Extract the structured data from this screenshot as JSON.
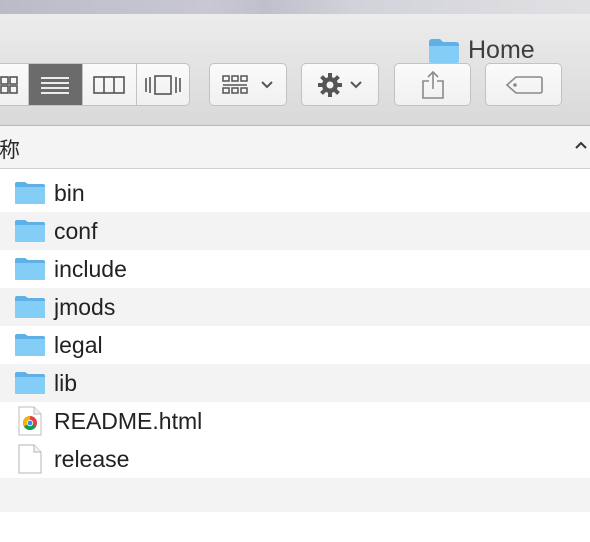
{
  "window": {
    "title": "Home",
    "title_icon": "folder-icon"
  },
  "toolbar": {
    "view_buttons": [
      {
        "name": "icon-view",
        "icon": "grid-icon"
      },
      {
        "name": "list-view",
        "icon": "list-icon",
        "selected": true
      },
      {
        "name": "column-view",
        "icon": "columns-icon"
      },
      {
        "name": "gallery-view",
        "icon": "coverflow-icon"
      }
    ],
    "arrange": {
      "icon": "arrange-icon"
    },
    "action": {
      "icon": "gear-icon"
    },
    "share": {
      "icon": "share-icon"
    },
    "tags": {
      "icon": "tag-icon"
    }
  },
  "header": {
    "name_column": "称",
    "sort": "ascending"
  },
  "files": [
    {
      "name": "bin",
      "type": "folder"
    },
    {
      "name": "conf",
      "type": "folder"
    },
    {
      "name": "include",
      "type": "folder"
    },
    {
      "name": "jmods",
      "type": "folder"
    },
    {
      "name": "legal",
      "type": "folder"
    },
    {
      "name": "lib",
      "type": "folder"
    },
    {
      "name": "README.html",
      "type": "html"
    },
    {
      "name": "release",
      "type": "file"
    }
  ],
  "colors": {
    "folder": "#76c4f3",
    "folder_tab": "#5fb0e6",
    "selected_segment": "#6b6b6b"
  }
}
